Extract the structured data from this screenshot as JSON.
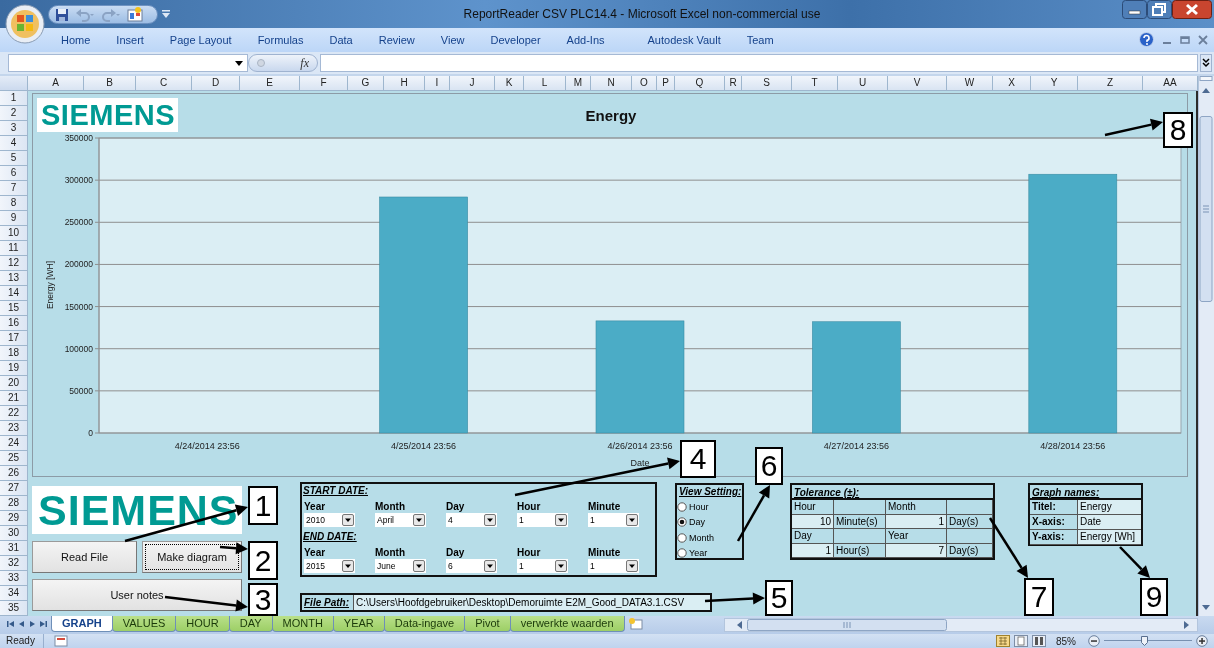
{
  "window": {
    "title": "ReportReader CSV PLC14.4 - Microsoft Excel non-commercial use"
  },
  "ribbon_tabs": [
    "Home",
    "Insert",
    "Page Layout",
    "Formulas",
    "Data",
    "Review",
    "View",
    "Developer",
    "Add-Ins",
    "Autodesk Vault",
    "Team"
  ],
  "formula_bar": {
    "function_label": "fx"
  },
  "columns": [
    "A",
    "B",
    "C",
    "D",
    "E",
    "F",
    "G",
    "H",
    "I",
    "J",
    "K",
    "L",
    "M",
    "N",
    "O",
    "P",
    "Q",
    "R",
    "S",
    "T",
    "U",
    "V",
    "W",
    "X",
    "Y",
    "Z",
    "AA"
  ],
  "rows": [
    "1",
    "2",
    "3",
    "4",
    "5",
    "6",
    "7",
    "8",
    "9",
    "10",
    "11",
    "12",
    "13",
    "14",
    "15",
    "16",
    "17",
    "18",
    "19",
    "20",
    "21",
    "22",
    "23",
    "24",
    "25",
    "26",
    "27",
    "28",
    "29",
    "30",
    "31",
    "32",
    "33",
    "34",
    "35"
  ],
  "chart": {
    "logo": "SIEMENS",
    "chart_data": {
      "type": "bar",
      "title": "Energy",
      "xlabel": "Date",
      "ylabel": "Energy [WH]",
      "categories": [
        "4/24/2014 23:56",
        "4/25/2014 23:56",
        "4/26/2014 23:56",
        "4/27/2014 23:56",
        "4/28/2014 23:56"
      ],
      "grid": true,
      "series": [
        {
          "color": "#4bacc6",
          "values": [
            0,
            280000,
            133000,
            132000,
            307000
          ]
        }
      ],
      "ylim": [
        0,
        350000
      ],
      "yticks": [
        0,
        50000,
        100000,
        150000,
        200000,
        250000,
        300000,
        350000
      ]
    }
  },
  "logo": "SIEMENS",
  "buttons": [
    {
      "label": "Read File",
      "focused": false
    },
    {
      "label": "Make diagram",
      "focused": true
    },
    {
      "label": "User notes",
      "focused": false
    }
  ],
  "date_range": {
    "start": {
      "heading": "START DATE:",
      "fields": [
        {
          "label": "Year",
          "value": "2010"
        },
        {
          "label": "Month",
          "value": "April"
        },
        {
          "label": "Day",
          "value": "4"
        },
        {
          "label": "Hour",
          "value": "1"
        },
        {
          "label": "Minute",
          "value": "1"
        }
      ]
    },
    "end": {
      "heading": "END DATE:",
      "fields": [
        {
          "label": "Year",
          "value": "2015"
        },
        {
          "label": "Month",
          "value": "June"
        },
        {
          "label": "Day",
          "value": "6"
        },
        {
          "label": "Hour",
          "value": "1"
        },
        {
          "label": "Minute",
          "value": "1"
        }
      ]
    }
  },
  "file_path": {
    "label": "File Path:",
    "value": "C:\\Users\\Hoofdgebruiker\\Desktop\\Demoruimte E2M_Good_DATA3.1.CSV"
  },
  "view_setting": {
    "heading": "View Setting:",
    "options": [
      {
        "label": "Hour",
        "selected": false
      },
      {
        "label": "Day",
        "selected": true
      },
      {
        "label": "Month",
        "selected": false
      },
      {
        "label": "Year",
        "selected": false
      }
    ]
  },
  "tolerance": {
    "heading": "Tolerance (±):",
    "units": [
      {
        "label": "Hour",
        "value": "10",
        "unit": "Minute(s)"
      },
      {
        "label": "Month",
        "value": "1",
        "unit": "Day(s)"
      },
      {
        "label": "Day",
        "value": "1",
        "unit": "Hour(s)"
      },
      {
        "label": "Year",
        "value": "7",
        "unit": "Day(s)"
      }
    ]
  },
  "graph_names": {
    "heading": "Graph names:",
    "rows": [
      {
        "label": "Titel:",
        "value": "Energy"
      },
      {
        "label": "X-axis:",
        "value": "Date"
      },
      {
        "label": "Y-axis:",
        "value": "Energy [Wh]"
      }
    ]
  },
  "callouts": [
    "1",
    "2",
    "3",
    "4",
    "5",
    "6",
    "7",
    "8",
    "9"
  ],
  "sheet_tabs": [
    {
      "label": "GRAPH",
      "selected": true
    },
    {
      "label": "VALUES",
      "selected": false
    },
    {
      "label": "HOUR",
      "selected": false
    },
    {
      "label": "DAY",
      "selected": false
    },
    {
      "label": "MONTH",
      "selected": false
    },
    {
      "label": "YEAR",
      "selected": false
    },
    {
      "label": "Data-ingave",
      "selected": false
    },
    {
      "label": "Pivot",
      "selected": false
    },
    {
      "label": "verwerkte waarden",
      "selected": false
    }
  ],
  "status_bar": {
    "text": "Ready",
    "zoom": "85%",
    "zoom_slider": {
      "level": 0.45
    }
  }
}
